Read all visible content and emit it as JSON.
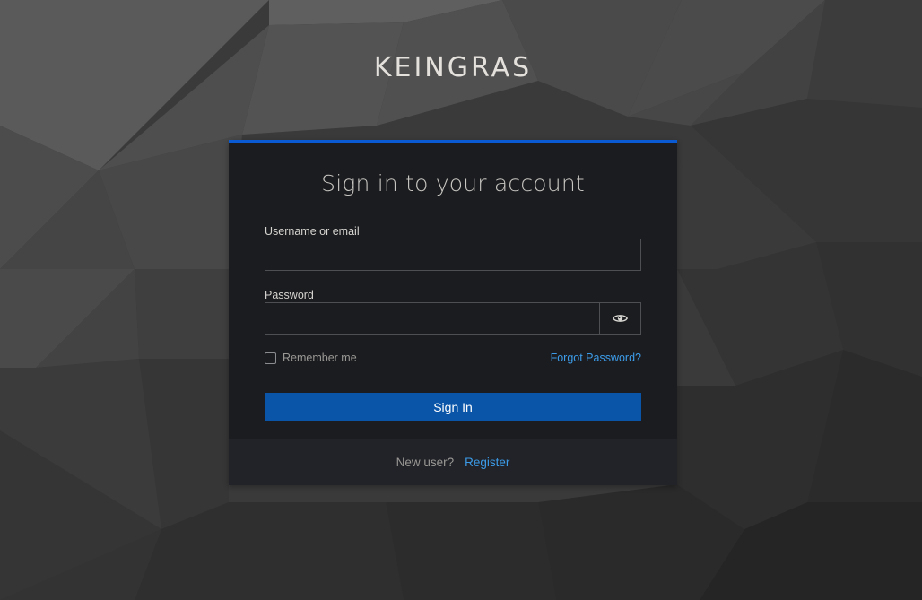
{
  "brand": {
    "title": "KEINGRAS"
  },
  "login": {
    "heading": "Sign in to your account",
    "username_label": "Username or email",
    "username_value": "",
    "password_label": "Password",
    "password_value": "",
    "show_password_icon": "eye-icon",
    "remember_label": "Remember me",
    "remember_checked": false,
    "forgot_label": "Forgot Password?",
    "submit_label": "Sign In"
  },
  "footer": {
    "new_user_text": "New user?",
    "register_label": "Register"
  },
  "colors": {
    "accent": "#0a5ad4",
    "button": "#0a55a8",
    "link": "#3c9be8",
    "card_bg": "#1b1c1f"
  }
}
